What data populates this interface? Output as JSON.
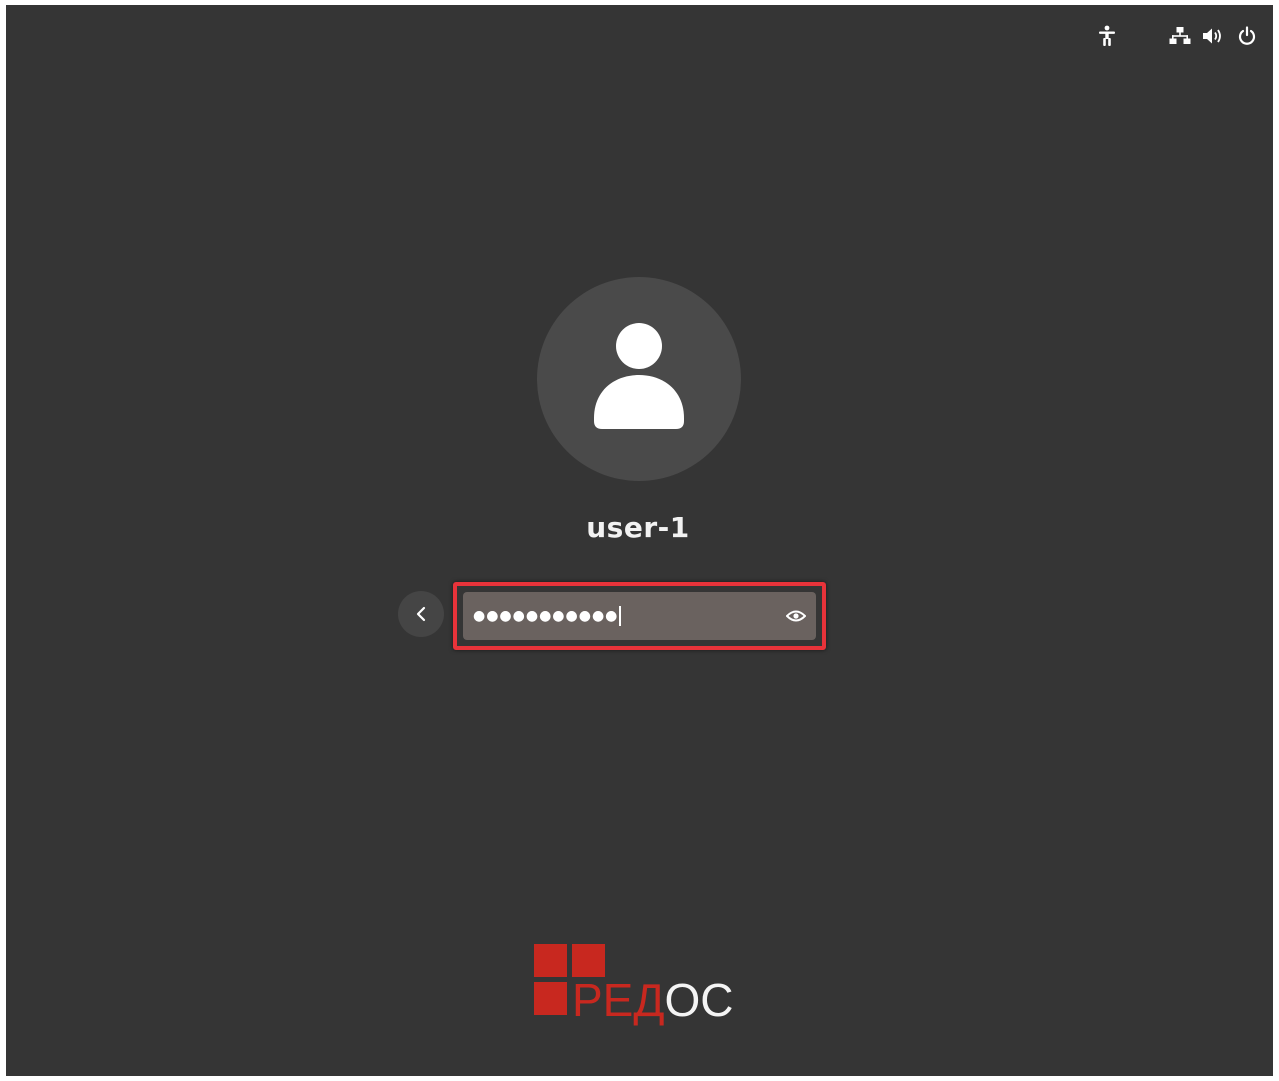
{
  "top_bar": {
    "icons": [
      "accessibility-icon",
      "network-icon",
      "volume-icon",
      "power-icon"
    ]
  },
  "login": {
    "username": "user-1",
    "password_mask": "●●●●●●●●●●●",
    "back_icon": "chevron-left-icon",
    "reveal_icon": "eye-icon"
  },
  "branding": {
    "logo_text_red": "РЕД",
    "logo_text_white": "ОС"
  },
  "colors": {
    "background": "#353535",
    "highlight_border": "#e8333a",
    "brand_red": "#c8281f"
  }
}
